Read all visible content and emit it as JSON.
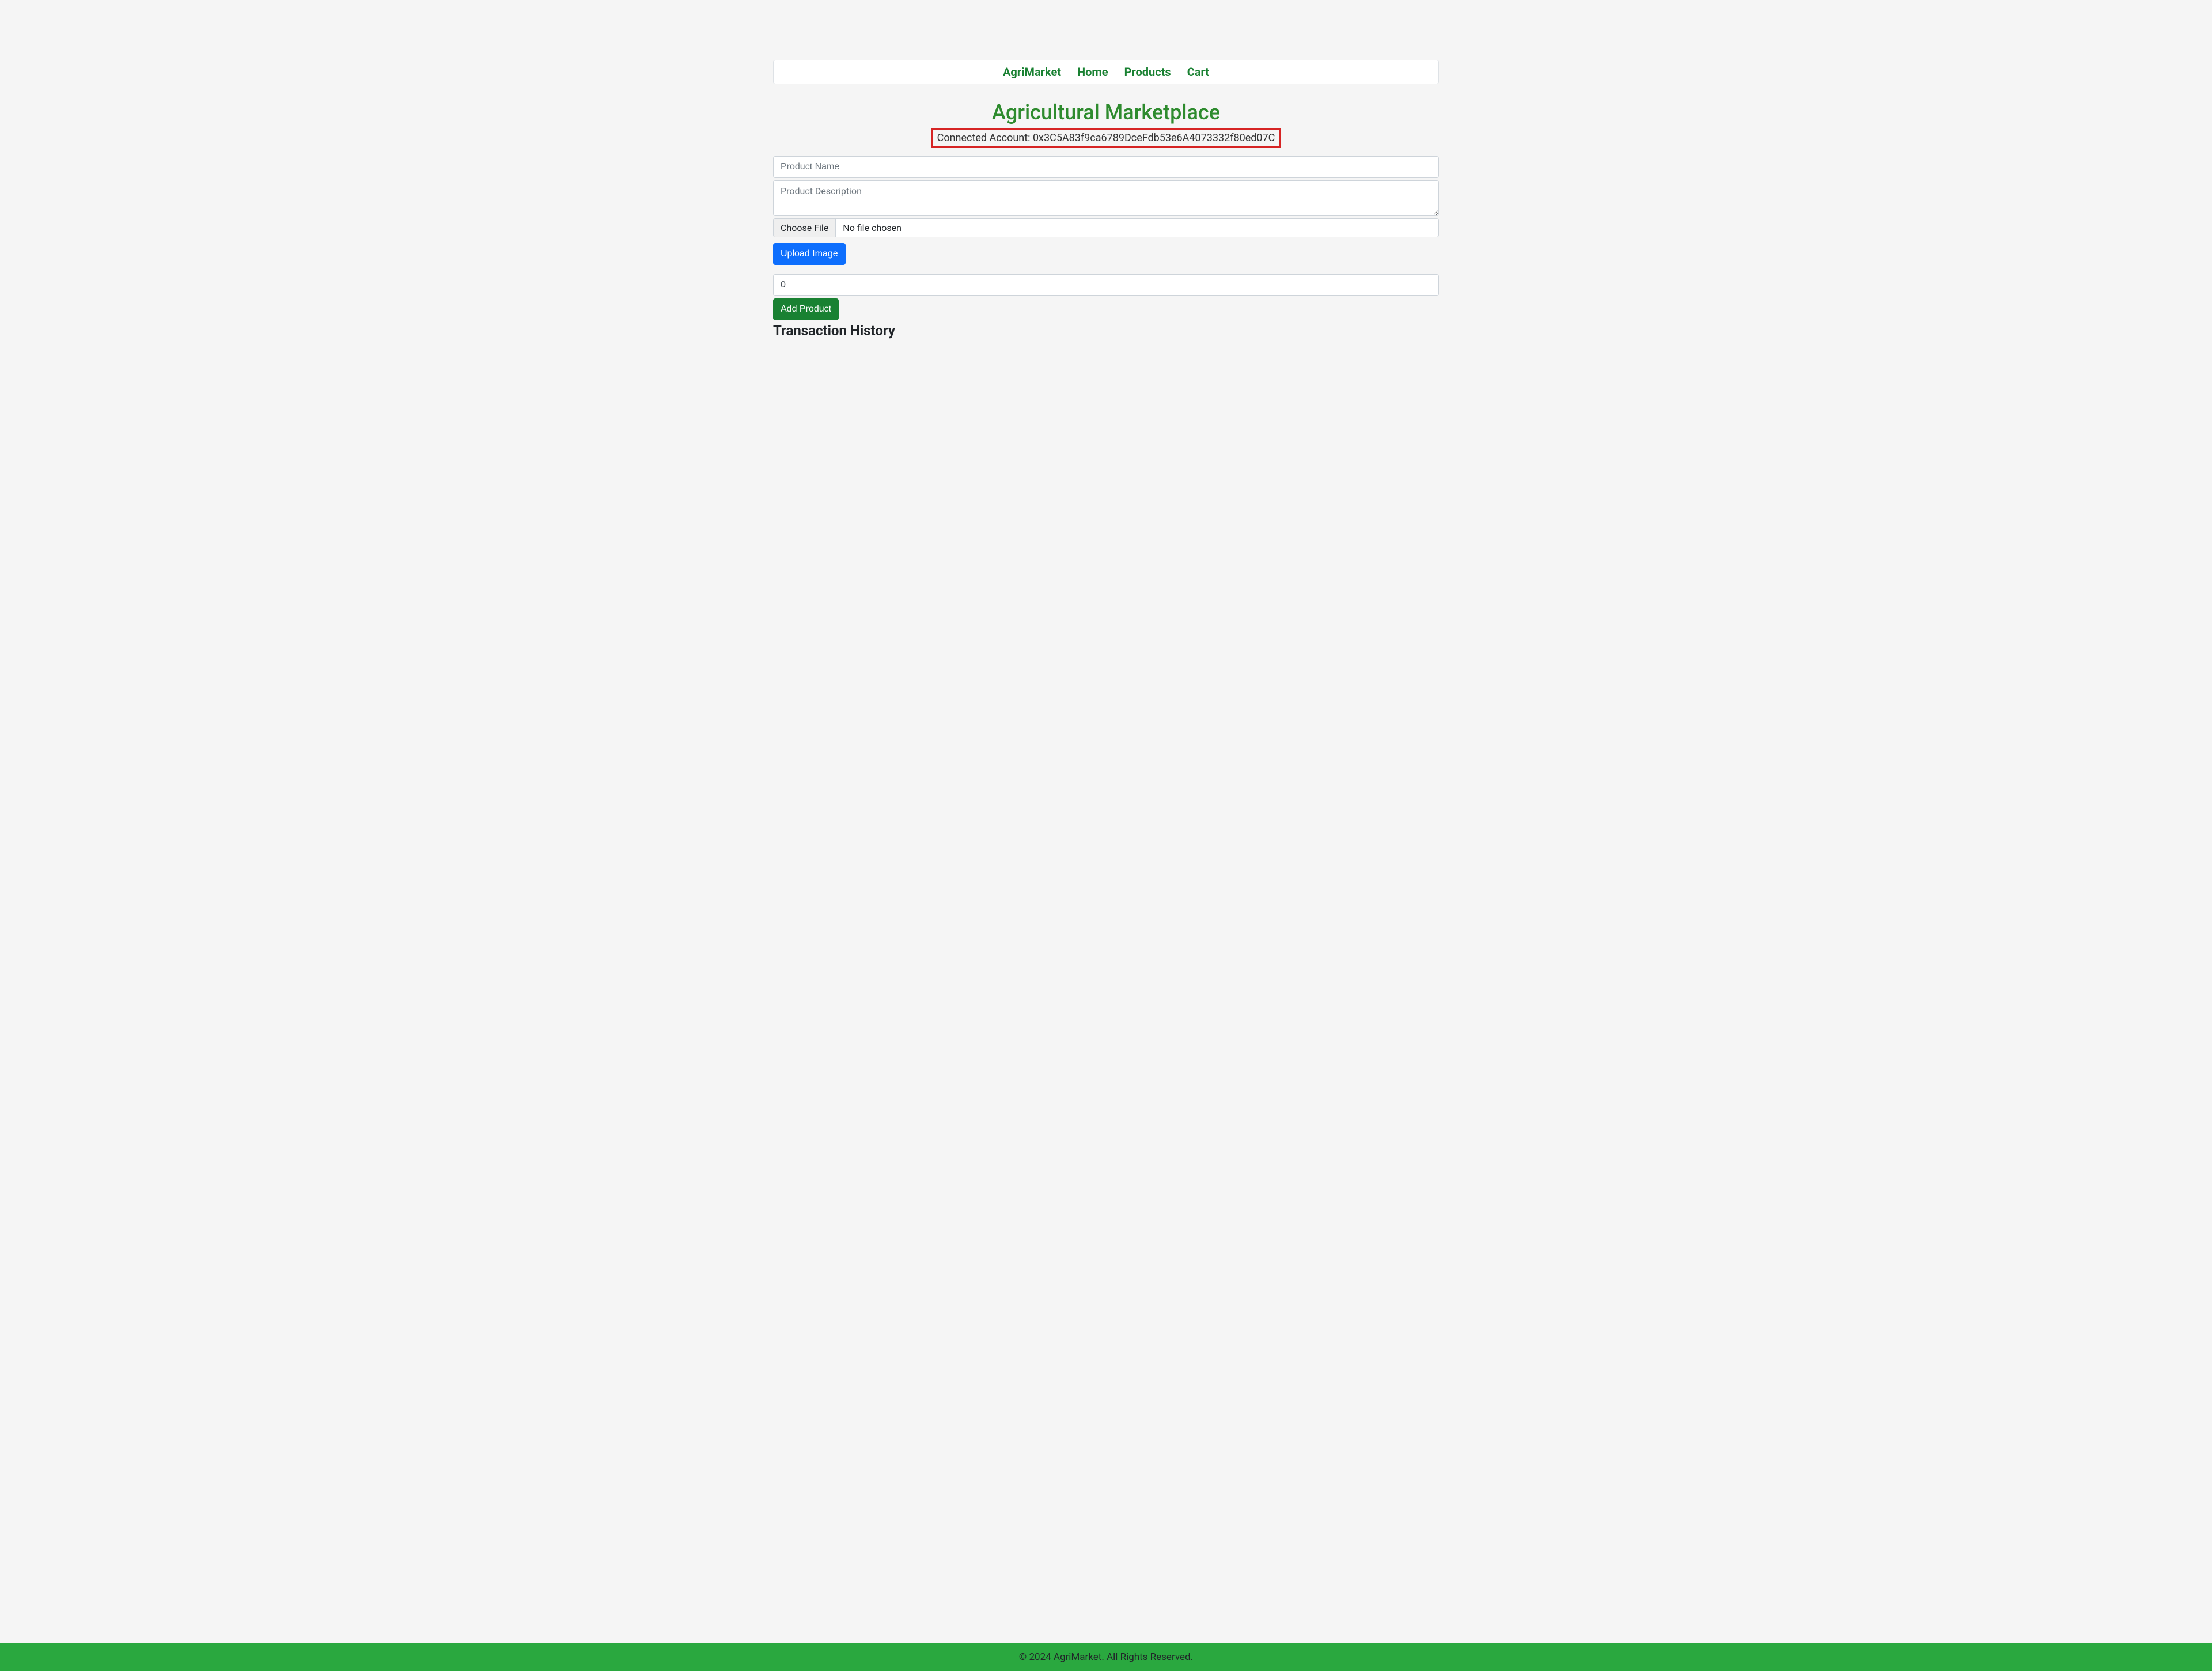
{
  "nav": {
    "brand": "AgriMarket",
    "links": {
      "home": "Home",
      "products": "Products",
      "cart": "Cart"
    }
  },
  "page": {
    "title": "Agricultural Marketplace",
    "connected_account_label": "Connected Account: ",
    "connected_account_value": "0x3C5A83f9ca6789DceFdb53e6A4073332f80ed07C"
  },
  "form": {
    "product_name_placeholder": "Product Name",
    "product_description_placeholder": "Product Description",
    "file_button": "Choose File",
    "file_text": "No file chosen",
    "upload_button": "Upload Image",
    "quantity_value": "0",
    "add_button": "Add Product"
  },
  "transaction": {
    "heading": "Transaction History"
  },
  "footer": {
    "text": "© 2024 AgriMarket. All Rights Reserved."
  }
}
